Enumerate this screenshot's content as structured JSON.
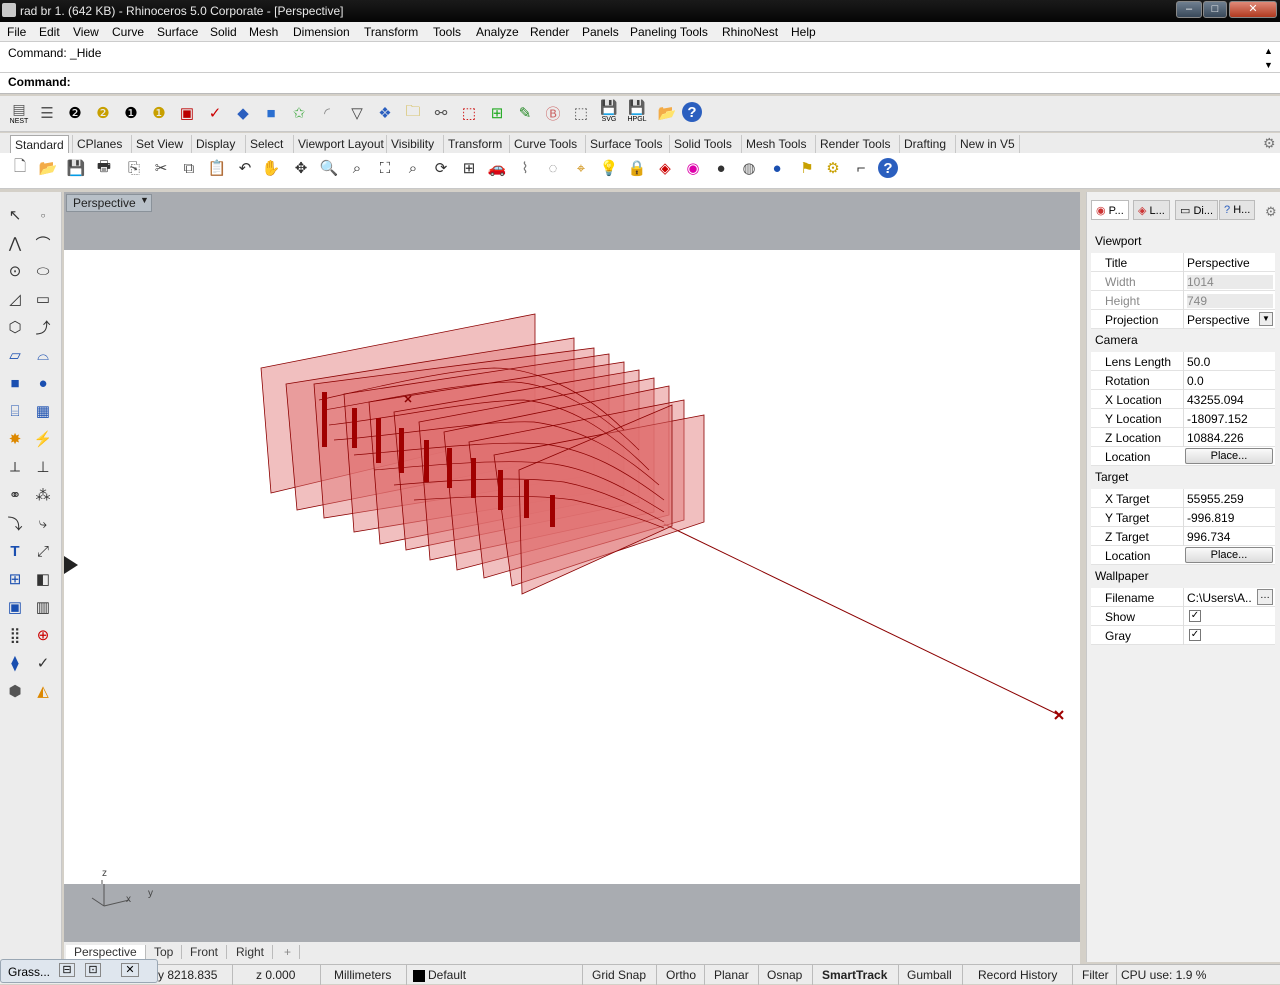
{
  "window": {
    "title": "rad br 1. (642 KB) - Rhinoceros  5.0 Corporate - [Perspective]",
    "minimize": "–",
    "maximize": "□",
    "close": "✕"
  },
  "menu": [
    "File",
    "Edit",
    "View",
    "Curve",
    "Surface",
    "Solid",
    "Mesh",
    "Dimension",
    "Transform",
    "Tools",
    "Analyze",
    "Render",
    "Panels",
    "Paneling Tools",
    "RhinoNest",
    "Help"
  ],
  "command": {
    "history": "Command: _Hide",
    "prompt": "Command:"
  },
  "toolbar_top": {
    "nest_label": "NEST",
    "svg_label": "SVG",
    "hpgl_label": "HPGL"
  },
  "tabs": [
    "Standard",
    "CPlanes",
    "Set View",
    "Display",
    "Select",
    "Viewport Layout",
    "Visibility",
    "Transform",
    "Curve Tools",
    "Surface Tools",
    "Solid Tools",
    "Mesh Tools",
    "Render Tools",
    "Drafting",
    "New in V5"
  ],
  "viewport": {
    "label": "Perspective",
    "axis_z": "z",
    "axis_y": "y",
    "axis_x": "x"
  },
  "view_tabs": [
    "Perspective",
    "Top",
    "Front",
    "Right",
    "+"
  ],
  "panel": {
    "tabs": [
      "P...",
      "L...",
      "Di...",
      "H..."
    ],
    "sections": {
      "viewport": "Viewport",
      "camera": "Camera",
      "target": "Target",
      "wallpaper": "Wallpaper"
    },
    "viewport_rows": [
      {
        "k": "Title",
        "v": "Perspective"
      },
      {
        "k": "Width",
        "v": "1014"
      },
      {
        "k": "Height",
        "v": "749"
      },
      {
        "k": "Projection",
        "v": "Perspective"
      }
    ],
    "camera_rows": [
      {
        "k": "Lens Length",
        "v": "50.0"
      },
      {
        "k": "Rotation",
        "v": "0.0"
      },
      {
        "k": "X Location",
        "v": "43255.094"
      },
      {
        "k": "Y Location",
        "v": "-18097.152"
      },
      {
        "k": "Z Location",
        "v": "10884.226"
      },
      {
        "k": "Location",
        "v": "Place..."
      }
    ],
    "target_rows": [
      {
        "k": "X Target",
        "v": "55955.259"
      },
      {
        "k": "Y Target",
        "v": "-996.819"
      },
      {
        "k": "Z Target",
        "v": "996.734"
      },
      {
        "k": "Location",
        "v": "Place..."
      }
    ],
    "wallpaper_rows": [
      {
        "k": "Filename",
        "v": "C:\\Users\\A..."
      },
      {
        "k": "Show",
        "v": "✓"
      },
      {
        "k": "Gray",
        "v": "✓"
      }
    ]
  },
  "status": {
    "grasshopper": "Grass...",
    "y_coord": "y 8218.835",
    "z_coord": "z 0.000",
    "units": "Millimeters",
    "layer": "Default",
    "toggles": [
      "Grid Snap",
      "Ortho",
      "Planar",
      "Osnap",
      "SmartTrack",
      "Gumball",
      "Record History",
      "Filter"
    ],
    "cpu": "CPU use: 1.9 %"
  },
  "colors": {
    "plane_fill": "#e07070",
    "plane_stroke": "#8b0000",
    "accent": "#b01010"
  }
}
